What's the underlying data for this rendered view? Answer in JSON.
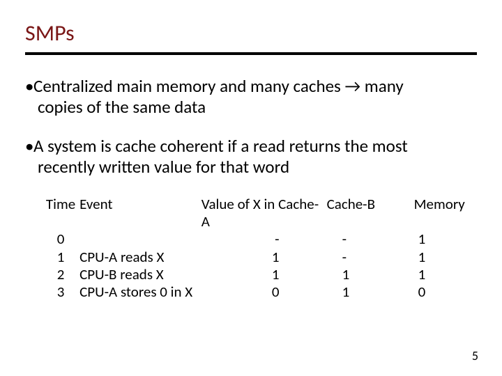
{
  "title": "SMPs",
  "bullets": [
    {
      "line1": "Centralized main memory and many caches → many",
      "line2": "copies of the same data"
    },
    {
      "line1": "A system is cache coherent if a read returns the most",
      "line2": "recently written value for that word"
    }
  ],
  "table": {
    "headers": {
      "time": "Time",
      "event": "Event",
      "cache_a": "Value of X in  Cache-A",
      "cache_b": "Cache-B",
      "memory": "Memory"
    },
    "rows": [
      {
        "time": "0",
        "event": "",
        "a": "-",
        "b": "-",
        "m": "1"
      },
      {
        "time": "1",
        "event": "CPU-A reads X",
        "a": "1",
        "b": "-",
        "m": "1"
      },
      {
        "time": "2",
        "event": "CPU-B reads X",
        "a": "1",
        "b": "1",
        "m": "1"
      },
      {
        "time": "3",
        "event": "CPU-A stores 0 in X",
        "a": "0",
        "b": "1",
        "m": "0"
      }
    ]
  },
  "page_number": "5"
}
